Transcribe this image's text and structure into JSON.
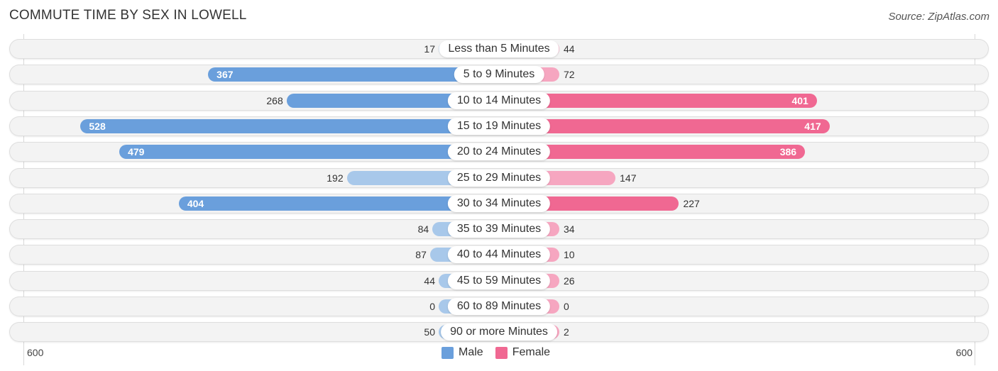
{
  "chart_data": {
    "type": "bar",
    "orientation": "horizontal-diverging",
    "title": "COMMUTE TIME BY SEX IN LOWELL",
    "source": "Source: ZipAtlas.com",
    "categories": [
      "Less than 5 Minutes",
      "5 to 9 Minutes",
      "10 to 14 Minutes",
      "15 to 19 Minutes",
      "20 to 24 Minutes",
      "25 to 29 Minutes",
      "30 to 34 Minutes",
      "35 to 39 Minutes",
      "40 to 44 Minutes",
      "45 to 59 Minutes",
      "60 to 89 Minutes",
      "90 or more Minutes"
    ],
    "series": [
      {
        "name": "Male",
        "values": [
          17,
          367,
          268,
          528,
          479,
          192,
          404,
          84,
          87,
          44,
          0,
          50
        ],
        "color": "#6a9fdc",
        "color_light": "#a8c8ea"
      },
      {
        "name": "Female",
        "values": [
          44,
          72,
          401,
          417,
          386,
          147,
          227,
          34,
          10,
          26,
          0,
          2
        ],
        "color": "#f06892",
        "color_light": "#f6a6c0"
      }
    ],
    "axis": {
      "left_label": "600",
      "right_label": "600",
      "max": 600
    },
    "legend": {
      "position": "bottom-center",
      "items": [
        "Male",
        "Female"
      ]
    },
    "grid": false
  }
}
